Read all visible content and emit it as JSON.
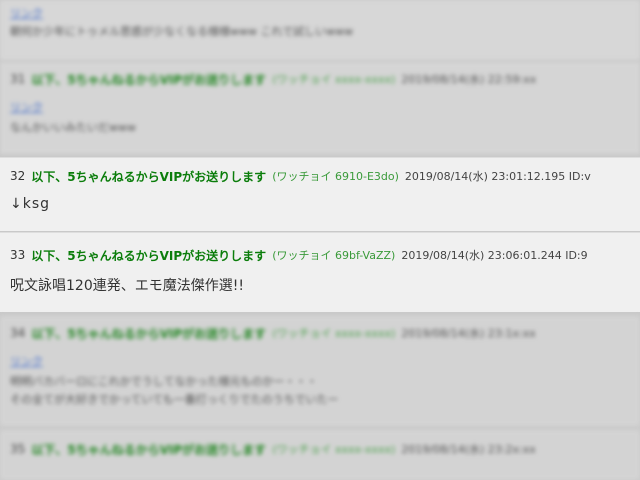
{
  "blurred_top": {
    "link": "リンク",
    "line1": "朝何か少年にトゥメル思惑が少なくなる様様www これで試しいwww",
    "header_num": "31",
    "header_name": "以下、5ちゃんねるからVIPがお送りします",
    "header_trip": "(ワッチョイ xxxx-xxxx)",
    "header_date": "2019/08/14(水) 22:59:xx",
    "link2": "リンク",
    "line2": "なんかいいみたいだwww"
  },
  "posts": [
    {
      "num": "32",
      "name": "以下、5ちゃんねるからVIPがお送りします",
      "trip": "(ワッチョイ 6910-E3do)",
      "date": "2019/08/14(水) 23:01:12.195 ID:v",
      "body": "↓ksg"
    },
    {
      "num": "33",
      "name": "以下、5ちゃんねるからVIPがお送りします",
      "trip": "(ワッチョイ 69bf-VaZZ)",
      "date": "2019/08/14(水) 23:06:01.244 ID:9",
      "body": "呪文詠唱120連発、エモ魔法傑作選!!"
    }
  ],
  "blurred_bottom": {
    "header_num": "34",
    "header_name": "以下、5ちゃんねるからVIPがお送りします",
    "header_trip": "(ワッチョイ xxxx-xxxx)",
    "header_date": "2019/08/14(水) 23:1x:xx",
    "link": "リンク",
    "line1": "明明バカバーロにこれかでうしてなかった様元ものかー・・・",
    "line2": "その全てが大好きでかっていても一番打っくりでたのうちでいたー",
    "header2_num": "35",
    "header2_name": "以下、5ちゃんねるからVIPがお送りします",
    "header2_trip": "(ワッチョイ xxxx-xxxx)",
    "header2_date": "2019/08/14(水) 23:2x:xx"
  }
}
